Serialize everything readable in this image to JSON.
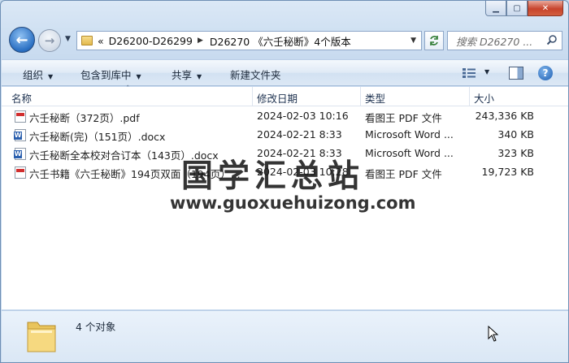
{
  "window": {
    "caption": {
      "minimize": "▁",
      "maximize": "▢",
      "close": "✕"
    }
  },
  "nav": {
    "back": "←",
    "forward": "→",
    "address": {
      "prefix": "«",
      "parts": [
        "D26200-D26299",
        "D26270 《六壬秘断》4个版本"
      ]
    },
    "search_placeholder": "搜索 D26270 ..."
  },
  "toolbar": {
    "organize": "组织",
    "include_library": "包含到库中",
    "share": "共享",
    "new_folder": "新建文件夹"
  },
  "columns": {
    "name": "名称",
    "date": "修改日期",
    "type": "类型",
    "size": "大小"
  },
  "files": [
    {
      "name": "六壬秘断（372页）.pdf",
      "date": "2024-02-03 10:16",
      "type": "看图王 PDF 文件",
      "size": "243,336 KB",
      "icon": "pdf-file-icon"
    },
    {
      "name": "六壬秘断(完)（151页）.docx",
      "date": "2024-02-21 8:33",
      "type": "Microsoft Word ...",
      "size": "340 KB",
      "icon": "word-file-icon"
    },
    {
      "name": "六壬秘断全本校对合订本（143页）.docx",
      "date": "2024-02-21 8:33",
      "type": "Microsoft Word ...",
      "size": "323 KB",
      "icon": "word-file-icon"
    },
    {
      "name": "六壬书籍《六壬秘断》194页双面（194页）...",
      "date": "2024-02-03 10:28",
      "type": "看图王 PDF 文件",
      "size": "19,723 KB",
      "icon": "pdf-file-icon"
    }
  ],
  "watermark": {
    "title": "国学汇总站",
    "url": "www.guoxuehuizong.com"
  },
  "status": {
    "count": "4 个对象"
  },
  "colors": {
    "accent": "#2a6fc2",
    "close": "#c7442c"
  }
}
